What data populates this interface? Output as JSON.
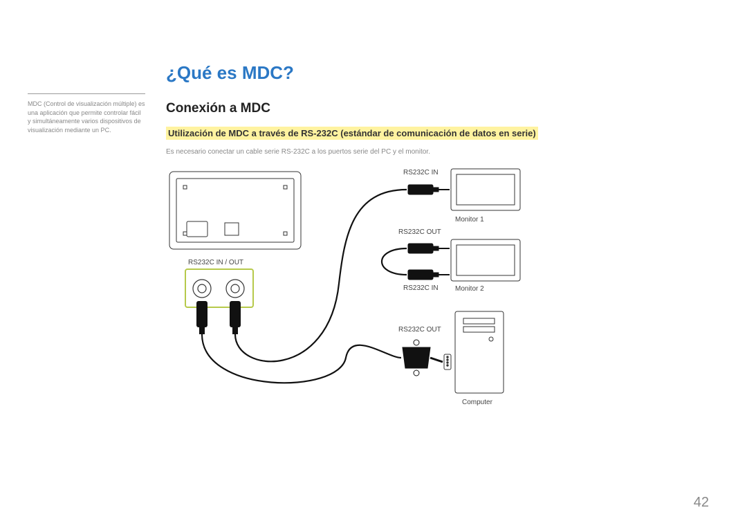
{
  "sidebar": {
    "note": "MDC (Control de visualización múltiple) es una aplicación que permite controlar fácil y simultáneamente varios dispositivos de visualización mediante un PC."
  },
  "main": {
    "title": "¿Qué es MDC?",
    "subtitle": "Conexión a MDC",
    "subheading": "Utilización de MDC a través de RS-232C (estándar de comunicación de datos en serie)",
    "desc": "Es necesario conectar un cable serie RS-232C a los puertos serie del PC y el monitor."
  },
  "diagram": {
    "port_panel": "RS232C IN / OUT",
    "rs_in_1": "RS232C IN",
    "rs_out_1": "RS232C OUT",
    "rs_in_2": "RS232C IN",
    "rs_out_2": "RS232C OUT",
    "monitor1": "Monitor 1",
    "monitor2": "Monitor 2",
    "computer": "Computer"
  },
  "page_number": "42"
}
